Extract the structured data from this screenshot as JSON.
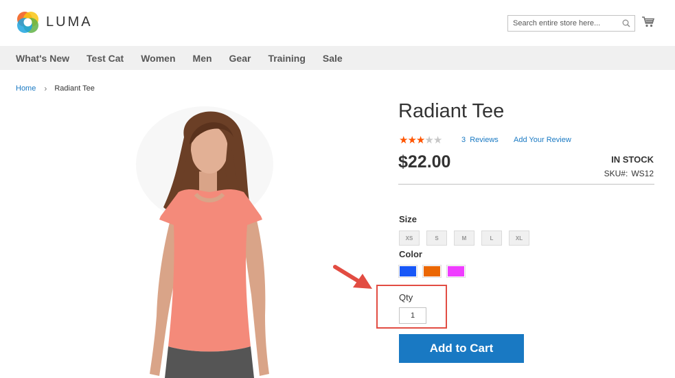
{
  "header": {
    "logo_text": "LUMA",
    "search_placeholder": "Search entire store here..."
  },
  "nav": {
    "items": [
      "What's New",
      "Test Cat",
      "Women",
      "Men",
      "Gear",
      "Training",
      "Sale"
    ]
  },
  "breadcrumb": {
    "home": "Home",
    "separator": "›",
    "current": "Radiant Tee"
  },
  "product": {
    "title": "Radiant Tee",
    "rating": 3,
    "rating_max": 5,
    "reviews_link": "3  Reviews",
    "add_review_link": "Add Your Review",
    "price": "$22.00",
    "stock": "IN STOCK",
    "sku_label": "SKU#:",
    "sku_value": "WS12",
    "size_label": "Size",
    "sizes": [
      "XS",
      "S",
      "M",
      "L",
      "XL"
    ],
    "color_label": "Color",
    "colors": [
      "#1857f7",
      "#eb6703",
      "#ef3dff"
    ],
    "qty_label": "Qty",
    "qty_value": "1",
    "add_to_cart": "Add to Cart"
  },
  "colors": {
    "accent": "#1979c3",
    "nav_bg": "#f0f0f0",
    "star_on": "#ff5501",
    "star_off": "#c7c7c7",
    "highlight": "#e24c42"
  }
}
